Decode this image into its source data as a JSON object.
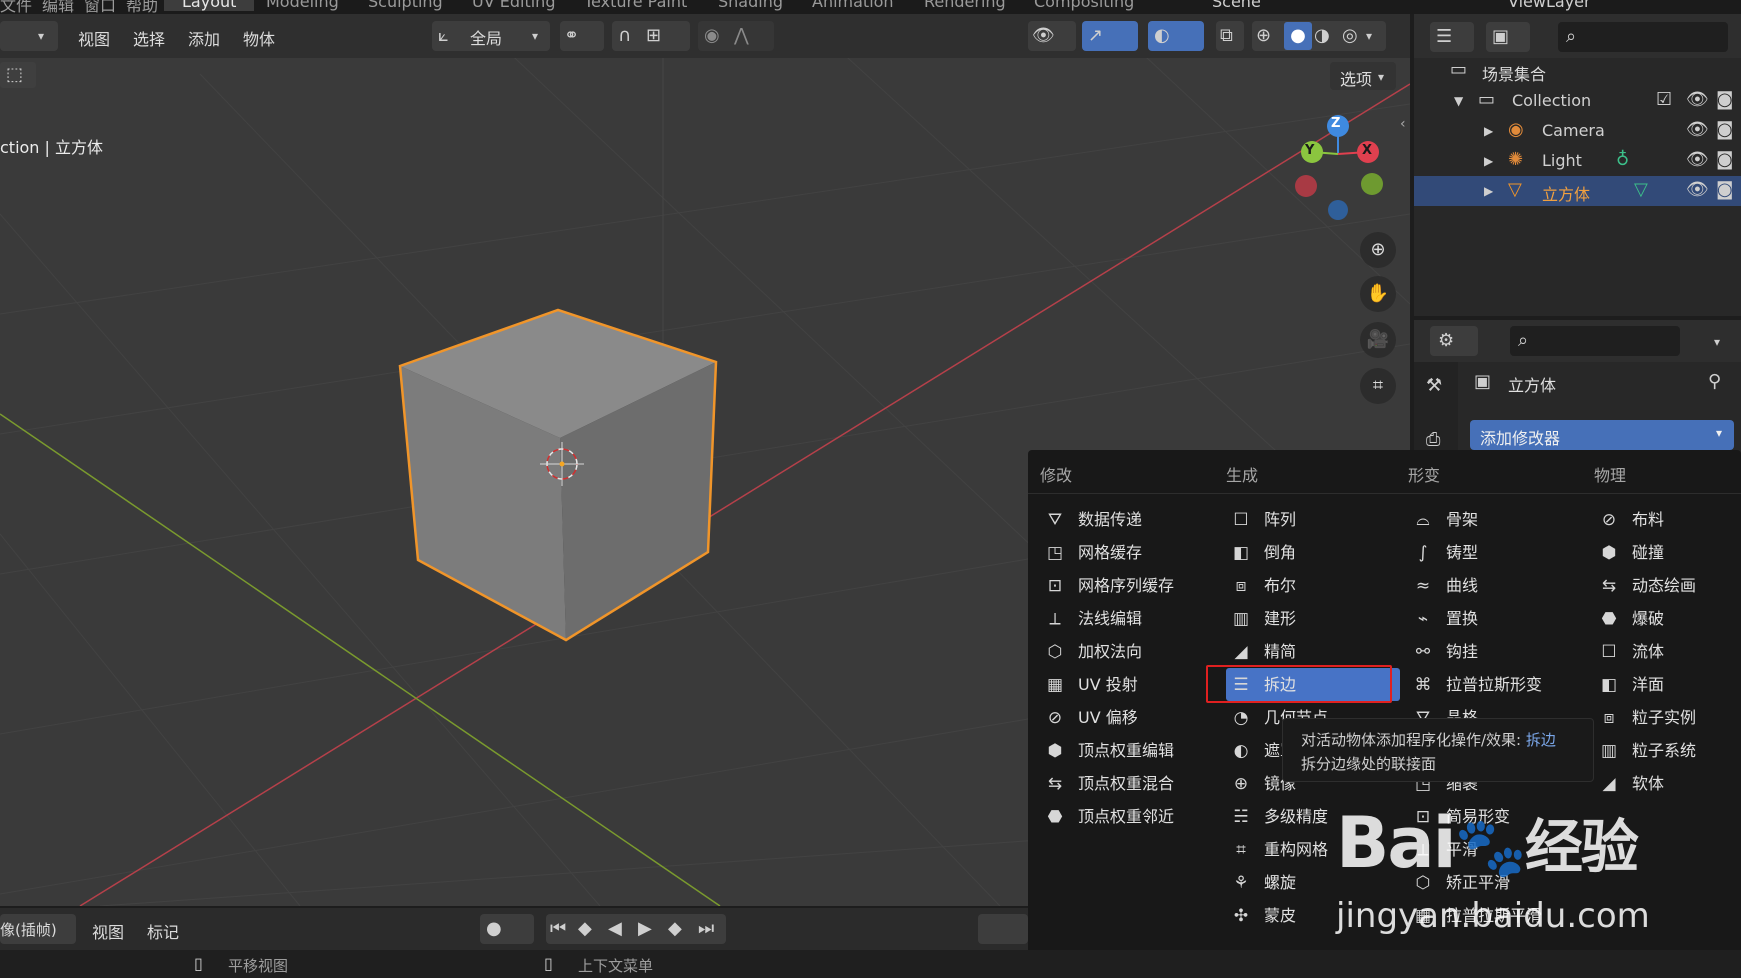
{
  "top_tabs": [
    "文件",
    "编辑",
    "窗口",
    "帮助",
    "Layout",
    "Modeling",
    "Sculpting",
    "UV Editing",
    "Texture Paint",
    "Shading",
    "Animation",
    "Rendering",
    "Compositing"
  ],
  "scene_name": "Scene",
  "view_layer": "ViewLayer",
  "viewport": {
    "menus": [
      "视图",
      "选择",
      "添加",
      "物体"
    ],
    "transform_orientation": "全局",
    "options_label": "选项",
    "object_info": "ction | 立方体"
  },
  "gizmo": {
    "z": "Z",
    "y": "Y",
    "x": "X"
  },
  "outliner": {
    "scene_collection": "场景集合",
    "items": [
      {
        "label": "Collection",
        "icon": "collection-icon"
      },
      {
        "label": "Camera",
        "icon": "camera-icon"
      },
      {
        "label": "Light",
        "icon": "light-icon"
      },
      {
        "label": "立方体",
        "icon": "mesh-icon",
        "selected": true
      }
    ]
  },
  "properties": {
    "object_name": "立方体",
    "add_modifier": "添加修改器"
  },
  "modifier_menu": {
    "columns": [
      {
        "title": "修改",
        "items": [
          "数据传递",
          "网格缓存",
          "网格序列缓存",
          "法线编辑",
          "加权法向",
          "UV 投射",
          "UV 偏移",
          "顶点权重编辑",
          "顶点权重混合",
          "顶点权重邻近"
        ]
      },
      {
        "title": "生成",
        "items": [
          "阵列",
          "倒角",
          "布尔",
          "建形",
          "精简",
          "拆边",
          "几何节点",
          "遮罩",
          "镜像",
          "多级精度",
          "重构网格",
          "螺旋",
          "蒙皮"
        ]
      },
      {
        "title": "形变",
        "items": [
          "骨架",
          "铸型",
          "曲线",
          "置换",
          "钩挂",
          "拉普拉斯形变",
          "晶格",
          "",
          "缩裹",
          "简易形变",
          "平滑",
          "矫正平滑",
          "拉普拉斯平滑"
        ]
      },
      {
        "title": "物理",
        "items": [
          "布料",
          "碰撞",
          "动态绘画",
          "爆破",
          "流体",
          "洋面",
          "粒子实例",
          "粒子系统",
          "软体"
        ]
      }
    ],
    "highlighted": "拆边",
    "tooltip_line1_prefix": "对活动物体添加程序化操作/效果: ",
    "tooltip_line1_em": "拆边",
    "tooltip_line2": "拆分边缘处的联接面"
  },
  "timeline": {
    "mode": "像(插帧)",
    "menus": [
      "视图",
      "标记"
    ]
  },
  "status": {
    "left": "平移视图",
    "middle": "上下文菜单"
  },
  "watermark": {
    "brand": "Bai",
    "brand2": "经验",
    "url": "jingyan.baidu.com"
  },
  "colors": {
    "accent": "#4773c6",
    "selection_outline": "#f0952a",
    "highlight_box": "#e02020",
    "gizmo_x": "#e0404f",
    "gizmo_y": "#8bc53f",
    "gizmo_z": "#3f8ae0"
  }
}
